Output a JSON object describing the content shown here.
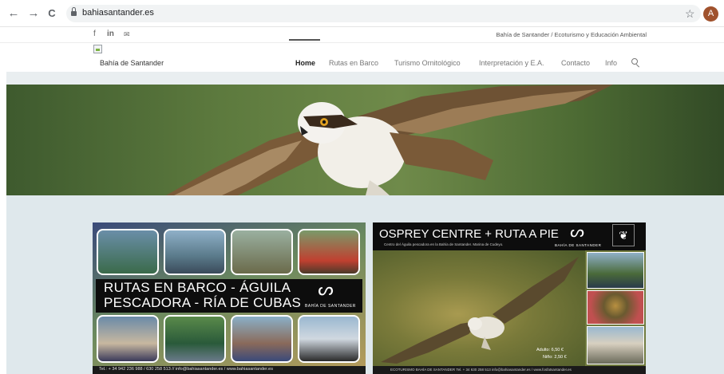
{
  "browser": {
    "back_icon": "←",
    "forward_icon": "→",
    "reload_icon": "C",
    "url": "bahiasantander.es",
    "bookmark_icon": "☆",
    "profile_initial": "A",
    "profile_color": "#a0522d"
  },
  "topbar": {
    "social": {
      "facebook": "f",
      "linkedin": "in",
      "email": "✉"
    },
    "tagline": "Bahía de Santander / Ecoturismo y Educación Ambiental"
  },
  "header": {
    "site_name": "Bahía de Santander",
    "nav": [
      "Home",
      "Rutas en Barco",
      "Turismo Ornitológico",
      "Interpretación y E.A.",
      "Contacto",
      "Info"
    ],
    "active_nav": "Home"
  },
  "posters": {
    "left": {
      "title_line1": "RUTAS EN BARCO - ÁGUILA",
      "title_line2": "PESCADORA - RÍA DE CUBAS",
      "logo_text": "BAHÍA DE SANTANDER",
      "footer": "Tel.: + 34 942 236 988 / 630 258 513  //  info@bahiasantander.es  /  www.bahiasantander.es"
    },
    "right": {
      "title": "OSPREY CENTRE + RUTA A PIE",
      "subtitle": "Centro del Águila pescadora en la Bahía de Santander. Marina de Cudeyo.",
      "logo_text": "BAHÍA DE SANTANDER",
      "price_adult": "Adulto: 6,50 €",
      "price_child": "Niño: 2,50 €",
      "footer": "ECOTURISMO BAHÍA DE SANTANDER   Tel. + 34  630 258 513   info@bahiasantander.es  /  www.fosfatsantander.es"
    }
  },
  "colors": {
    "content_bg": "#dfe8ec",
    "banner_bg": "#0d0d0d",
    "nav_active": "#222222"
  }
}
